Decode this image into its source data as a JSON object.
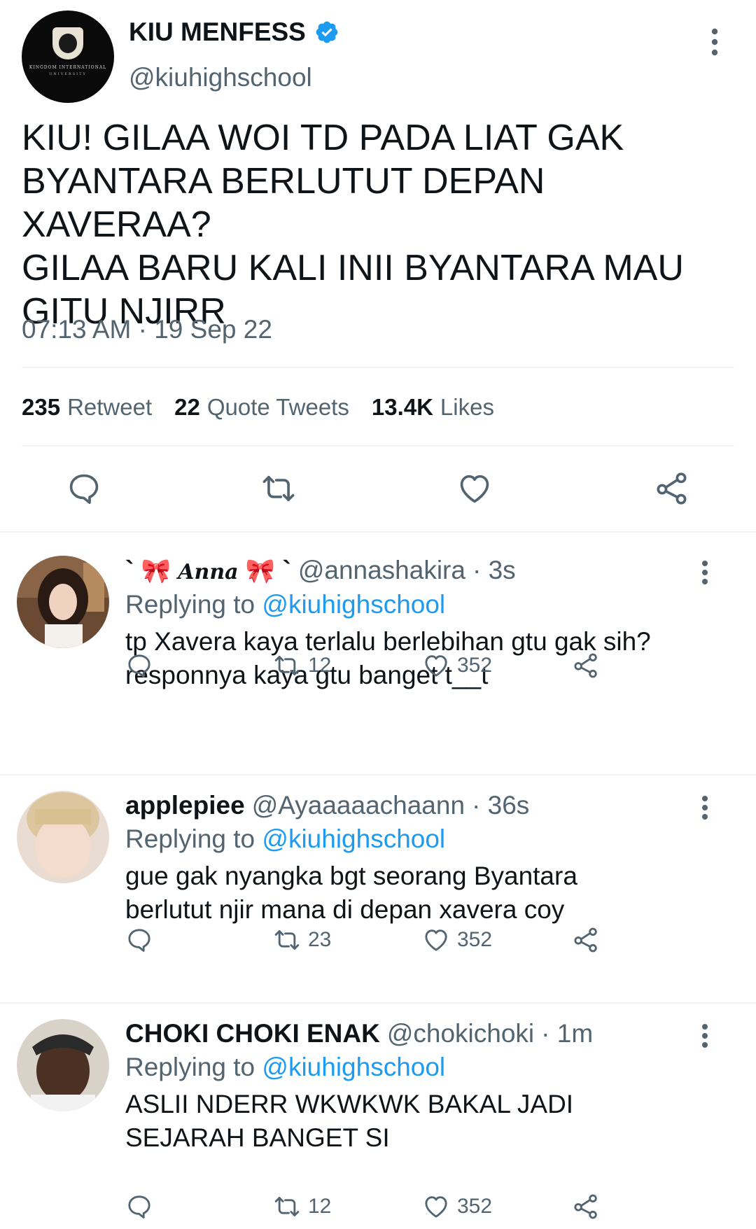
{
  "main_tweet": {
    "account_name": "KIU MENFESS",
    "handle": "@kiuhighschool",
    "avatar_line1": "KINGDOM INTERNATIONAL",
    "avatar_line2": "UNIVERSITY",
    "text": "KIU! GILAA WOI TD PADA LIAT GAK\nBYANTARA BERLUTUT DEPAN XAVERAA?\nGILAA BARU KALI INII BYANTARA MAU\nGITU NJIRR",
    "timestamp": "07:13 AM · 19 Sep 22",
    "stats": {
      "retweets_count": "235",
      "retweets_label": "Retweet",
      "quotes_count": "22",
      "quotes_label": "Quote Tweets",
      "likes_count": "13.4K",
      "likes_label": "Likes"
    },
    "actions": [
      "reply-icon",
      "retweet-icon",
      "like-icon",
      "share-icon"
    ]
  },
  "replies": [
    {
      "name_prefix": "`",
      "name_deco": "🎀",
      "name_script": "Anna",
      "name_suffix": "`",
      "handle": "@annashakira",
      "time": "· 3s",
      "replying_label": "Replying to",
      "replying_to": "@kiuhighschool",
      "text": "tp Xavera kaya terlalu berlebihan gtu gak sih?\nresponnya kaya gtu banget t__t",
      "retweets": "12",
      "likes": "352"
    },
    {
      "name": "applepiee",
      "handle": "@Ayaaaaachaann",
      "time": "· 36s",
      "replying_label": "Replying to",
      "replying_to": "@kiuhighschool",
      "text": "gue gak nyangka bgt seorang Byantara\nberlutut njir mana di depan xavera coy",
      "retweets": "23",
      "likes": "352"
    },
    {
      "name": "CHOKI CHOKI ENAK",
      "handle": "@chokichoki",
      "time": "· 1m",
      "replying_label": "Replying to",
      "replying_to": "@kiuhighschool",
      "text": "ASLII NDERR WKWKWK BAKAL JADI\nSEJARAH BANGET SI",
      "retweets": "12",
      "likes": "352"
    }
  ],
  "colors": {
    "accent": "#1d9bf0",
    "secondary_text": "#536471",
    "divider": "#eff3f4"
  }
}
